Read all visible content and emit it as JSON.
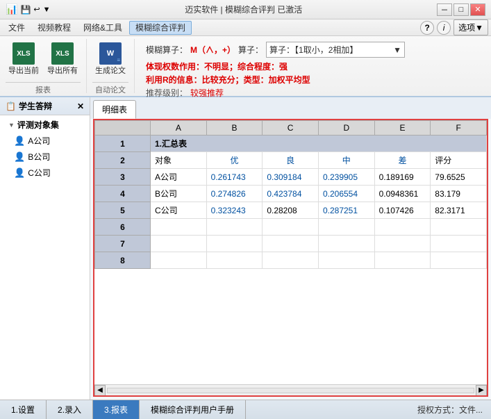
{
  "titleBar": {
    "title": "迈实软件 | 模糊综合评判 已激活",
    "minLabel": "－",
    "maxLabel": "□",
    "closeLabel": "✕"
  },
  "menuBar": {
    "items": [
      "文件",
      "视频教程",
      "网络&工具",
      "模糊综合评判"
    ],
    "activeIndex": 3,
    "rightItems": [
      "?",
      "i",
      "选项▼"
    ]
  },
  "ribbon": {
    "exportCurrentLabel": "导出当前",
    "exportAllLabel": "导出所有",
    "generateLabel": "生成论文",
    "autoLabel": "自动论文",
    "fuzzyOperatorLabel": "模糊算子：",
    "operatorM": "M（∧，+）",
    "operatorSelect": "算子：【1取小，2相加】",
    "featureLabel": "体现权数作用：不明显；综合程度：强",
    "rInfoLabel": "利用R的信息：比较充分；类型：加权平均型",
    "recommendLabel": "推荐级别：较强推荐"
  },
  "sidebar": {
    "header": "学生答辩",
    "closeBtn": "✕",
    "group": "评测对象集",
    "items": [
      "A公司",
      "B公司",
      "C公司"
    ]
  },
  "tabs": {
    "明细表": "明细表"
  },
  "table": {
    "columns": [
      "",
      "A",
      "B",
      "C",
      "D",
      "E",
      "F"
    ],
    "rows": [
      {
        "rowNum": "1",
        "data": [
          "1.汇总表",
          "",
          "",
          "",
          "",
          ""
        ]
      },
      {
        "rowNum": "2",
        "data": [
          "对象",
          "优",
          "良",
          "中",
          "差",
          "评分"
        ]
      },
      {
        "rowNum": "3",
        "data": [
          "A公司",
          "0.261743",
          "0.309184",
          "0.239905",
          "0.189169",
          "79.6525"
        ]
      },
      {
        "rowNum": "4",
        "data": [
          "B公司",
          "0.274826",
          "0.423784",
          "0.206554",
          "0.0948361",
          "83.179"
        ]
      },
      {
        "rowNum": "5",
        "data": [
          "C公司",
          "0.323243",
          "0.28208",
          "0.287251",
          "0.107426",
          "82.3171"
        ]
      }
    ]
  },
  "statusBar": {
    "btn1": "1.设置",
    "btn2": "2.录入",
    "btn3": "3.报表",
    "btn4": "模糊综合评判用户手册",
    "rightText": "授权方式：文件..."
  }
}
